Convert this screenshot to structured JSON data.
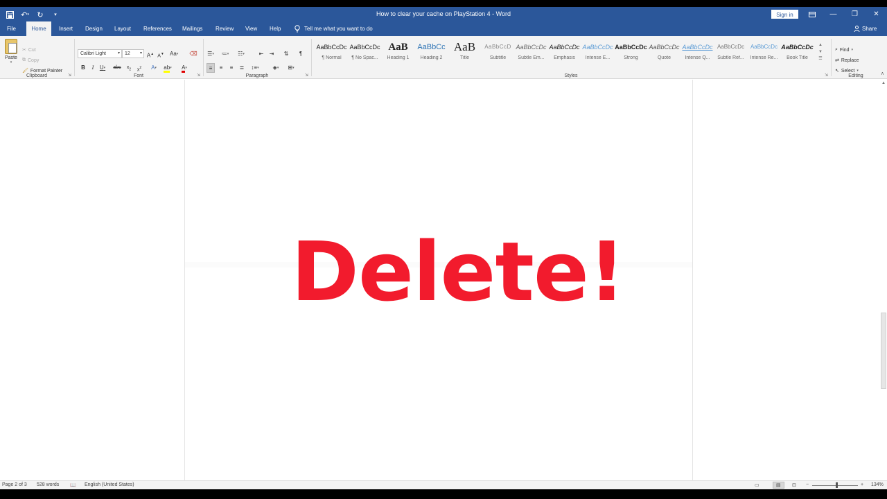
{
  "window": {
    "title": "How to clear your cache on PlayStation 4  -  Word",
    "sign_in": "Sign in"
  },
  "tabs": [
    {
      "label": "File"
    },
    {
      "label": "Home"
    },
    {
      "label": "Insert"
    },
    {
      "label": "Design"
    },
    {
      "label": "Layout"
    },
    {
      "label": "References"
    },
    {
      "label": "Mailings"
    },
    {
      "label": "Review"
    },
    {
      "label": "View"
    },
    {
      "label": "Help"
    }
  ],
  "tell_me": "Tell me what you want to do",
  "share": "Share",
  "clipboard": {
    "paste": "Paste",
    "cut": "Cut",
    "copy": "Copy",
    "format_painter": "Format Painter",
    "label": "Clipboard"
  },
  "font": {
    "name": "Calibri Light",
    "size": "12",
    "label": "Font"
  },
  "paragraph": {
    "label": "Paragraph"
  },
  "styles": {
    "label": "Styles",
    "items": [
      {
        "preview": "AaBbCcDc",
        "name": "¶ Normal"
      },
      {
        "preview": "AaBbCcDc",
        "name": "¶ No Spac..."
      },
      {
        "preview": "AaB",
        "name": "Heading 1"
      },
      {
        "preview": "AaBbCc",
        "name": "Heading 2"
      },
      {
        "preview": "AaB",
        "name": "Title"
      },
      {
        "preview": "AaBbCcD",
        "name": "Subtitle"
      },
      {
        "preview": "AaBbCcDc",
        "name": "Subtle Em..."
      },
      {
        "preview": "AaBbCcDc",
        "name": "Emphasis"
      },
      {
        "preview": "AaBbCcDc",
        "name": "Intense E..."
      },
      {
        "preview": "AaBbCcDc",
        "name": "Strong"
      },
      {
        "preview": "AaBbCcDc",
        "name": "Quote"
      },
      {
        "preview": "AaBbCcDc",
        "name": "Intense Q..."
      },
      {
        "preview": "AaBbCcDc",
        "name": "Subtle Ref..."
      },
      {
        "preview": "AaBbCcDc",
        "name": "Intense Re..."
      },
      {
        "preview": "AaBbCcDc",
        "name": "Book Title"
      }
    ]
  },
  "editing": {
    "find": "Find",
    "replace": "Replace",
    "select": "Select",
    "label": "Editing"
  },
  "document": {
    "text": "Delete!",
    "text_color": "#f21b2d"
  },
  "status": {
    "page": "Page 2 of 3",
    "words": "528 words",
    "language": "English (United States)",
    "zoom": "134%"
  },
  "colors": {
    "accent": "#2b579a"
  }
}
